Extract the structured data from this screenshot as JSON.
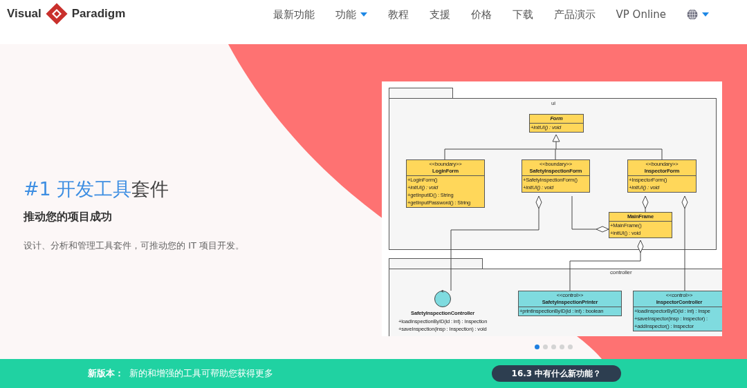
{
  "header": {
    "logo": {
      "word_left": "Visual",
      "word_right": "Paradigm"
    },
    "nav": [
      {
        "kind": "text",
        "label": "最新功能",
        "dropdown": false
      },
      {
        "kind": "text",
        "label": "功能",
        "dropdown": true
      },
      {
        "kind": "text",
        "label": "教程",
        "dropdown": false
      },
      {
        "kind": "text",
        "label": "支援",
        "dropdown": false
      },
      {
        "kind": "text",
        "label": "价格",
        "dropdown": false
      },
      {
        "kind": "text",
        "label": "下载",
        "dropdown": false
      },
      {
        "kind": "text",
        "label": "产品演示",
        "dropdown": false
      },
      {
        "kind": "text",
        "label": "VP Online",
        "dropdown": false
      },
      {
        "kind": "language",
        "dropdown": true
      }
    ]
  },
  "hero": {
    "title_highlight": "#1 开发工具",
    "title_rest": "套件",
    "subtitle": "推动您的项目成功",
    "description": "设计、分析和管理工具套件，可推动您的 IT 项目开发。",
    "diagram": {
      "packages": [
        {
          "name": "ui"
        },
        {
          "name": "controller"
        }
      ],
      "classes": [
        {
          "kind": "ui",
          "name": "Form",
          "name_italic": true,
          "operations": [
            {
              "text": "+initUI() : void",
              "italic": true
            }
          ]
        },
        {
          "kind": "ui",
          "stereotype": "<<boundary>>",
          "name": "LoginForm",
          "name_italic": false,
          "operations": [
            {
              "text": "+LoginForm()",
              "italic": false
            },
            {
              "text": "+initUI() : void",
              "italic": true
            },
            {
              "text": "+getInputID() : String",
              "italic": false
            },
            {
              "text": "+getInputPassword() : String",
              "italic": false
            }
          ]
        },
        {
          "kind": "ui",
          "stereotype": "<<boundary>>",
          "name": "SafetyInspectionForm",
          "name_italic": false,
          "operations": [
            {
              "text": "+SafetyInspectionForm()",
              "italic": false
            },
            {
              "text": "+initUI() : void",
              "italic": true
            }
          ]
        },
        {
          "kind": "ui",
          "stereotype": "<<boundary>>",
          "name": "InspectorForm",
          "name_italic": false,
          "operations": [
            {
              "text": "+InspectorForm()",
              "italic": false
            },
            {
              "text": "+initUI() : void",
              "italic": true
            }
          ]
        },
        {
          "kind": "ui",
          "name": "MainFrame",
          "name_italic": false,
          "operations": [
            {
              "text": "+MainFrame()",
              "italic": false
            },
            {
              "text": "+initUI() : void",
              "italic": false
            }
          ]
        },
        {
          "kind": "control-icon",
          "name": "SafetyInspectionController",
          "name_italic": false,
          "operations": [
            {
              "text": "+loadInspectionByID(id : int) : Inspection",
              "italic": false
            },
            {
              "text": "+saveInspection(insp : Inspection) : void",
              "italic": false
            }
          ]
        },
        {
          "kind": "controller",
          "stereotype": "<<control>>",
          "name": "SafetyInspectionPrinter",
          "name_italic": false,
          "operations": [
            {
              "text": "+printInspectionByID(id : int) : boolean",
              "italic": false
            }
          ]
        },
        {
          "kind": "controller",
          "stereotype": "<<control>>",
          "name": "InspectorController",
          "name_italic": false,
          "operations": [
            {
              "text": "+loadInspectorByID(id : int) : Inspe",
              "italic": false
            },
            {
              "text": "+saveInspector(insp : Inspector) :",
              "italic": false
            },
            {
              "text": "+addInspector() : Inspector",
              "italic": false
            }
          ]
        }
      ]
    },
    "carousel_dots": [
      {
        "selected": true
      },
      {
        "selected": false
      },
      {
        "selected": false
      },
      {
        "selected": false
      },
      {
        "selected": false
      }
    ]
  },
  "banner": {
    "label": "新版本：",
    "text": "新的和增强的工具可帮助您获得更多",
    "button": "16.3 中有什么新功能？"
  }
}
